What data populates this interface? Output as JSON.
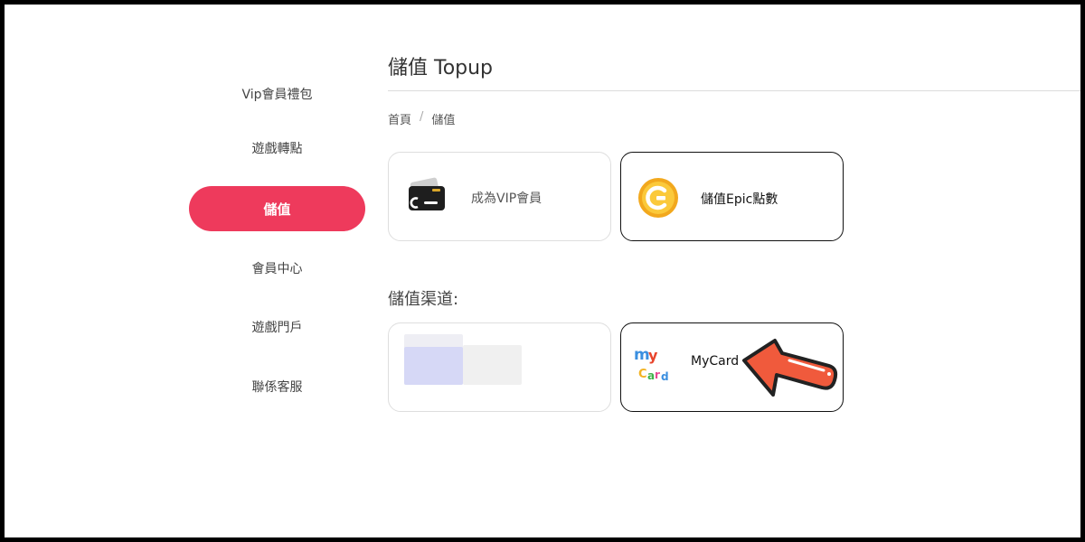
{
  "sidebar": {
    "items": [
      {
        "label": "Vip會員禮包",
        "active": false
      },
      {
        "label": "遊戲轉點",
        "active": false
      },
      {
        "label": "儲值",
        "active": true
      },
      {
        "label": "會員中心",
        "active": false
      },
      {
        "label": "遊戲門戶",
        "active": false
      },
      {
        "label": "聯係客服",
        "active": false
      }
    ],
    "active_color": "#ee3a5c"
  },
  "header": {
    "title": "儲值 Topup"
  },
  "breadcrumb": {
    "home": "首頁",
    "separator": "/",
    "current": "儲值"
  },
  "options": [
    {
      "label": "成為VIP會員",
      "icon": "credit-card-icon"
    },
    {
      "label": "儲值Epic點數",
      "icon": "epic-coin-icon"
    }
  ],
  "channels": {
    "title": "儲值渠道:",
    "items": [
      {
        "label": "",
        "icon": "blurred-channel-logo"
      },
      {
        "label": "MyCard",
        "icon": "mycard-logo",
        "logo_text": "myCard"
      }
    ]
  },
  "annotation": {
    "icon": "red-arrow-icon",
    "color": "#f05a3c"
  }
}
